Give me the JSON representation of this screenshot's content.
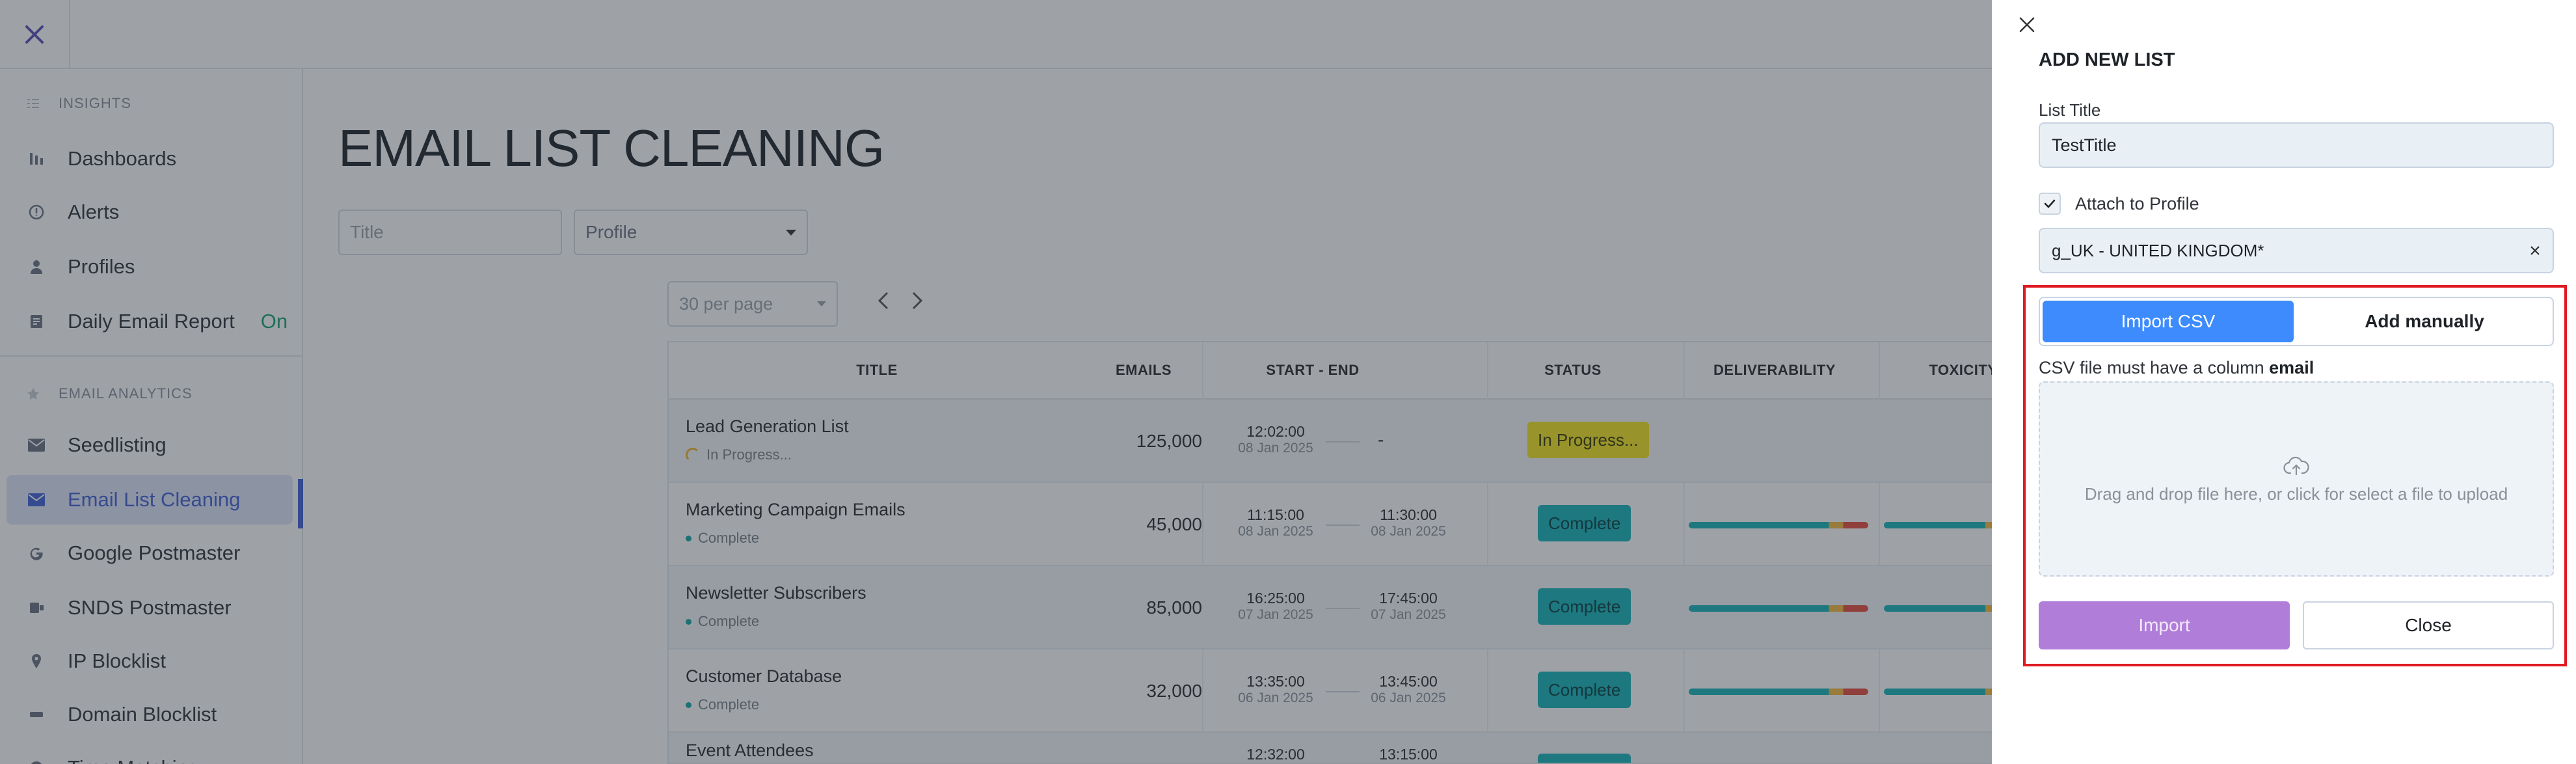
{
  "sidebar": {
    "sections": [
      {
        "label": "INSIGHTS"
      },
      {
        "label": "EMAIL ANALYTICS"
      }
    ],
    "items": [
      {
        "label": "Dashboards",
        "icon": "bar-chart-icon"
      },
      {
        "label": "Alerts",
        "icon": "alert-circle-icon"
      },
      {
        "label": "Profiles",
        "icon": "user-icon"
      },
      {
        "label": "Daily Email Report",
        "icon": "report-icon",
        "badge": "On"
      },
      {
        "label": "Seedlisting",
        "icon": "mail-icon"
      },
      {
        "label": "Email List Cleaning",
        "icon": "mail-icon",
        "active": true
      },
      {
        "label": "Google Postmaster",
        "icon": "google-icon"
      },
      {
        "label": "SNDS Postmaster",
        "icon": "snds-icon"
      },
      {
        "label": "IP Blocklist",
        "icon": "pin-icon"
      },
      {
        "label": "Domain Blocklist",
        "icon": "minus-icon"
      },
      {
        "label": "Time Matching",
        "icon": "clock-icon"
      }
    ]
  },
  "main": {
    "title": "EMAIL LIST CLEANING",
    "filters": {
      "title_placeholder": "Title",
      "profile_label": "Profile"
    },
    "per_page": "30 per page",
    "table": {
      "headers": [
        "TITLE",
        "EMAILS",
        "START - END",
        "STATUS",
        "DELIVERABILITY",
        "TOXICITY"
      ],
      "rows": [
        {
          "title": "Lead Generation List",
          "sub": "In Progress...",
          "emails": "125,000",
          "start_time": "12:02:00",
          "start_date": "08 Jan 2025",
          "end_time": "-",
          "end_date": "",
          "status": "In Progress..."
        },
        {
          "title": "Marketing Campaign Emails",
          "sub": "Complete",
          "emails": "45,000",
          "start_time": "11:15:00",
          "start_date": "08 Jan 2025",
          "end_time": "11:30:00",
          "end_date": "08 Jan 2025",
          "status": "Complete"
        },
        {
          "title": "Newsletter Subscribers",
          "sub": "Complete",
          "emails": "85,000",
          "start_time": "16:25:00",
          "start_date": "07 Jan 2025",
          "end_time": "17:45:00",
          "end_date": "07 Jan 2025",
          "status": "Complete"
        },
        {
          "title": "Customer Database",
          "sub": "Complete",
          "emails": "32,000",
          "start_time": "13:35:00",
          "start_date": "06 Jan 2025",
          "end_time": "13:45:00",
          "end_date": "06 Jan 2025",
          "status": "Complete"
        },
        {
          "title": "Event Attendees",
          "sub": "",
          "emails": "",
          "start_time": "12:32:00",
          "start_date": "",
          "end_time": "13:15:00",
          "end_date": "",
          "status": "Complete"
        }
      ]
    }
  },
  "drawer": {
    "title": "ADD NEW LIST",
    "list_title_label": "List Title",
    "list_title_value": "TestTitle",
    "attach_label": "Attach to Profile",
    "attach_checked": true,
    "profile_value": "g_UK - UNITED KINGDOM*",
    "tabs": {
      "import_csv": "Import CSV",
      "add_manually": "Add manually"
    },
    "csv_note_prefix": "CSV file must have a column ",
    "csv_note_column": "email",
    "dropzone_text": "Drag and drop file here, or click for select a file to upload",
    "import_label": "Import",
    "close_label": "Close"
  },
  "colors": {
    "accent": "#4360d6",
    "tab_active": "#3d8bfd",
    "import_button": "#b07ed8",
    "highlight": "#e01a22",
    "complete": "#15b3b8",
    "in_progress": "#f4e41c"
  }
}
